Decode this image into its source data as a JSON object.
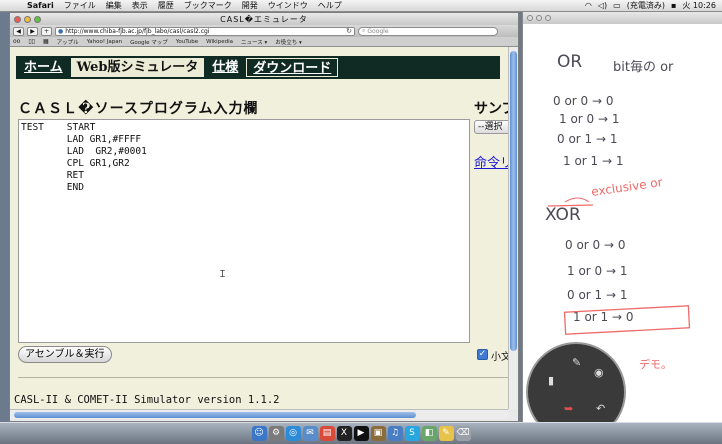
{
  "menubar": {
    "items": [
      "Safari",
      "ファイル",
      "編集",
      "表示",
      "履歴",
      "ブックマーク",
      "開発",
      "ウインドウ",
      "ヘルプ"
    ],
    "status": "(充電済み)",
    "clock": "火 10:26"
  },
  "browser": {
    "window_title": "CASL�エミュレータ",
    "url": "http://www.chiba-fjb.ac.jp/fjb_labo/casl/casl2.cgi",
    "search_placeholder": "Google",
    "bookmarks": [
      "アップル",
      "Yahoo! Japan",
      "Google マップ",
      "YouTube",
      "Wikipedia",
      "ニュース ▾",
      "お役立ち ▾"
    ]
  },
  "page": {
    "tabs": [
      {
        "label": "ホーム"
      },
      {
        "label": "Web版シミュレータ"
      },
      {
        "label": "仕様"
      },
      {
        "label": "ダウンロード"
      }
    ],
    "heading": "ＣＡＳＬ�ソースプログラム入力欄",
    "sample_label": "サンプ",
    "select_label": "--選択",
    "command_link": "命令リ",
    "source_code": "TEST    START\n        LAD GR1,#FFFF\n        LAD  GR2,#0001\n        CPL GR1,GR2\n        RET\n        END",
    "assemble_button": "アセンブル＆実行",
    "checkbox_label": "小文",
    "version": "CASL-II & COMET-II Simulator version 1.1.2"
  },
  "notes": {
    "or_title": "OR",
    "or_subtitle": "bit毎の or",
    "or_rows": [
      "0  or  0 → 0",
      "1  or  0 → 1",
      "0  or  1 → 1",
      "1  or  1 → 1"
    ],
    "xor_title": "XOR",
    "xor_annotation": "exclusive or",
    "xor_rows": [
      "0  or  0 → 0",
      "1  or  0 → 1",
      "0  or  1 → 1",
      "1  or  1 → 0"
    ],
    "demo": "デモ。"
  },
  "colors": {
    "nav_bg": "#102a24",
    "page_bg": "#f1f0dc",
    "link": "#1a1ad6",
    "ink_grey": "#4a4a55",
    "ink_red": "#f06a6a"
  },
  "dock_icons": [
    "finder-icon",
    "system-icon",
    "safari-icon",
    "mail-icon",
    "calendar-icon",
    "x-icon",
    "terminal-icon",
    "photo-icon",
    "itunes-icon",
    "skype-icon",
    "preview-icon",
    "notes-icon",
    "trash-icon"
  ]
}
